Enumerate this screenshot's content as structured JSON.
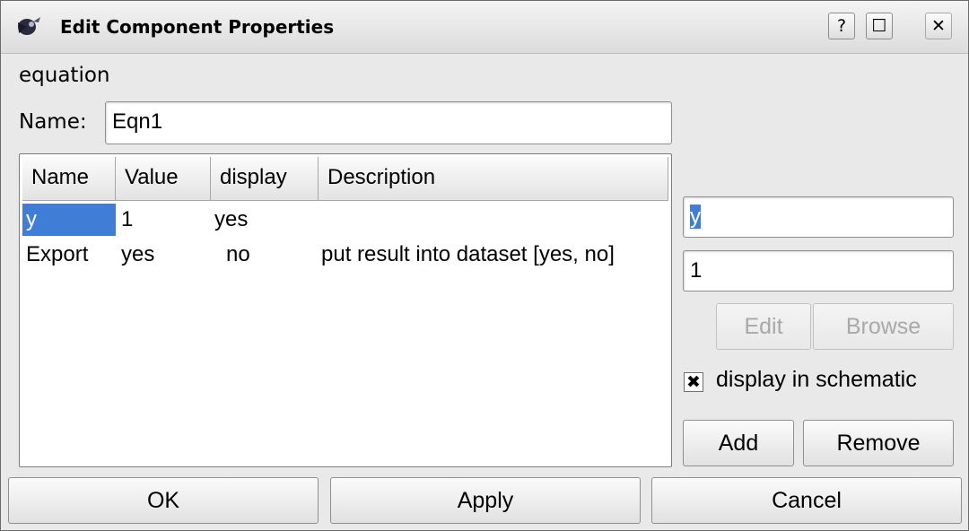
{
  "window": {
    "title": "Edit Component Properties",
    "help_label": "?",
    "maximize_label": "☐",
    "close_label": "✕"
  },
  "component": {
    "type_label": "equation",
    "name_label": "Name:",
    "name_value": "Eqn1"
  },
  "table": {
    "columns": [
      "Name",
      "Value",
      "display",
      "Description"
    ],
    "rows": [
      {
        "name": "y",
        "value": "1",
        "display": "yes",
        "description": ""
      },
      {
        "name": "Export",
        "value": "yes",
        "display": "no",
        "description": "put result into dataset [yes, no]"
      }
    ],
    "selected_row": 0
  },
  "editor": {
    "property_name": "y",
    "property_value": "1",
    "edit_label": "Edit",
    "browse_label": "Browse",
    "display_in_schematic_label": "display in schematic",
    "display_in_schematic_checked": true,
    "add_label": "Add",
    "remove_label": "Remove"
  },
  "footer": {
    "ok_label": "OK",
    "apply_label": "Apply",
    "cancel_label": "Cancel"
  },
  "colors": {
    "selection": "#3f7dd6",
    "window_bg": "#e9e9e9"
  }
}
